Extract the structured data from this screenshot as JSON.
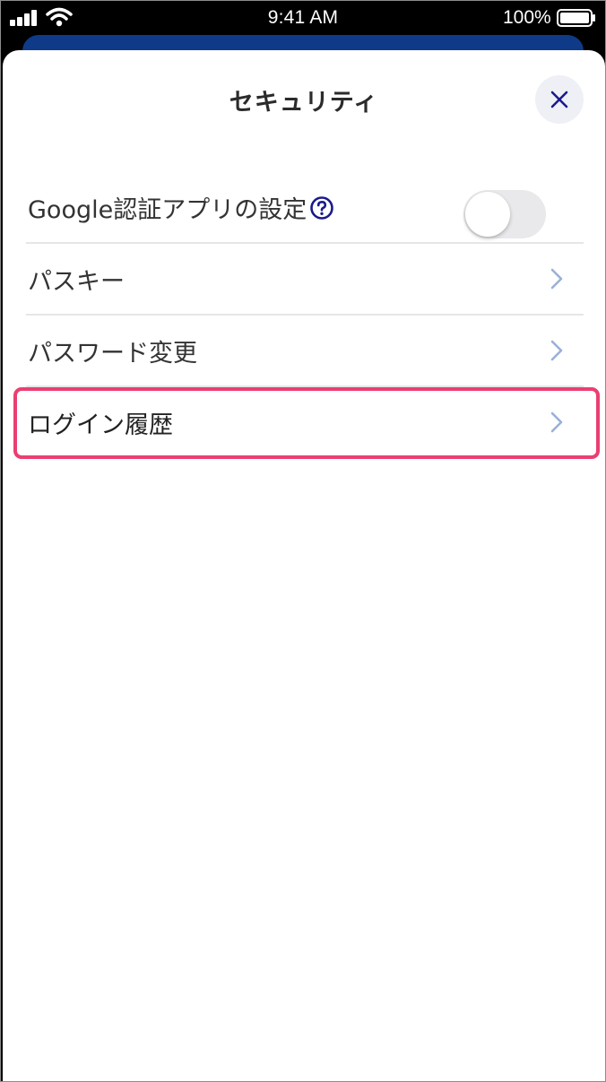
{
  "status_bar": {
    "time": "9:41 AM",
    "battery_percent": "100%",
    "icons": [
      "signal-icon",
      "wifi-icon",
      "battery-icon"
    ]
  },
  "sheet": {
    "title": "セキュリティ",
    "close_icon": "close-icon"
  },
  "settings": {
    "google_auth": {
      "label": "Google認証アプリの設定",
      "help_icon": "question-circle-icon",
      "toggle_on": false
    },
    "items": [
      {
        "label": "パスキー",
        "icon": "chevron-right-icon"
      },
      {
        "label": "パスワード変更",
        "icon": "chevron-right-icon"
      },
      {
        "label": "ログイン履歴",
        "icon": "chevron-right-icon",
        "highlighted": true
      }
    ]
  },
  "colors": {
    "accent_navy": "#1a1a8c",
    "brand_navy": "#0f3a87",
    "highlight_pink": "#ea3f72",
    "chevron": "#9ab0d8",
    "toggle_off": "#e9e9ec"
  }
}
